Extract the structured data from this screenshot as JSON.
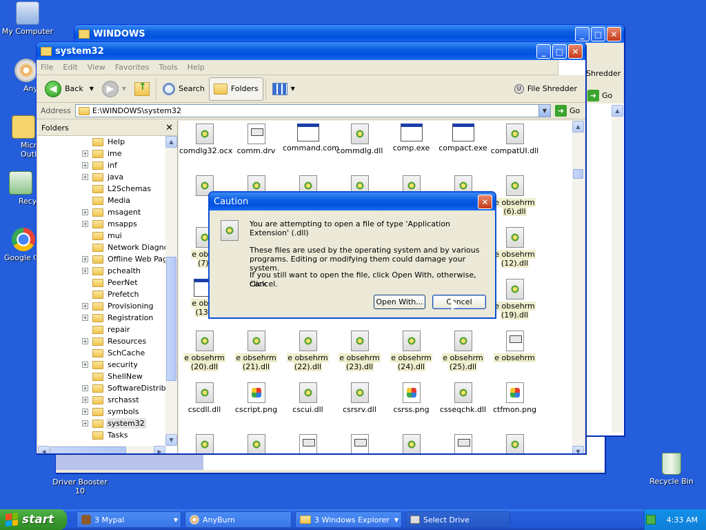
{
  "desktop": {
    "icons": [
      {
        "label": "My Computer"
      },
      {
        "label": "AnyBurn"
      },
      {
        "label": "Microsoft Outlook"
      },
      {
        "label": "Recycle"
      },
      {
        "label": "Google Chrome"
      },
      {
        "label": "Driver Booster 10"
      },
      {
        "label": "Recycle Bin"
      }
    ]
  },
  "window_windows": {
    "title": "WINDOWS",
    "toolbar_partial": "Shredder",
    "go_label": "Go"
  },
  "explorer": {
    "title": "system32",
    "menu": [
      "File",
      "Edit",
      "View",
      "Favorites",
      "Tools",
      "Help"
    ],
    "toolbar": {
      "back": "Back",
      "search": "Search",
      "folders": "Folders",
      "file_shredder": "File Shredder"
    },
    "address": {
      "label": "Address",
      "value": "E:\\WINDOWS\\system32",
      "go": "Go"
    },
    "folders_pane": {
      "title": "Folders",
      "items": [
        {
          "label": "Help",
          "expandable": false
        },
        {
          "label": "ime",
          "expandable": true
        },
        {
          "label": "inf",
          "expandable": true
        },
        {
          "label": "java",
          "expandable": true
        },
        {
          "label": "L2Schemas",
          "expandable": false
        },
        {
          "label": "Media",
          "expandable": false
        },
        {
          "label": "msagent",
          "expandable": true
        },
        {
          "label": "msapps",
          "expandable": true
        },
        {
          "label": "mui",
          "expandable": false
        },
        {
          "label": "Network Diagnost",
          "expandable": false
        },
        {
          "label": "Offline Web Page",
          "expandable": true
        },
        {
          "label": "pchealth",
          "expandable": true
        },
        {
          "label": "PeerNet",
          "expandable": false
        },
        {
          "label": "Prefetch",
          "expandable": false
        },
        {
          "label": "Provisioning",
          "expandable": true
        },
        {
          "label": "Registration",
          "expandable": true
        },
        {
          "label": "repair",
          "expandable": false
        },
        {
          "label": "Resources",
          "expandable": true
        },
        {
          "label": "SchCache",
          "expandable": false
        },
        {
          "label": "security",
          "expandable": true
        },
        {
          "label": "ShellNew",
          "expandable": false
        },
        {
          "label": "SoftwareDistribut",
          "expandable": true
        },
        {
          "label": "srchasst",
          "expandable": true
        },
        {
          "label": "symbols",
          "expandable": true
        },
        {
          "label": "system32",
          "expandable": true,
          "selected": true
        },
        {
          "label": "Tasks",
          "expandable": false
        }
      ]
    },
    "files": {
      "row1": [
        {
          "name": "comdlg32.ocx",
          "icon": "dll"
        },
        {
          "name": "comm.drv",
          "icon": "doc"
        },
        {
          "name": "command.com",
          "icon": "exe"
        },
        {
          "name": "commdlg.dll",
          "icon": "dll"
        },
        {
          "name": "comp.exe",
          "icon": "exe"
        },
        {
          "name": "compact.exe",
          "icon": "exe"
        },
        {
          "name": "compatUI.dll",
          "icon": "dll"
        }
      ],
      "row2_last": [
        "e obsehrm",
        "(6).dll"
      ],
      "row3_first": [
        "e obse",
        "(7)."
      ],
      "row3_last": [
        "e obsehrm",
        "(12).dll"
      ],
      "row4_first": [
        "e obse",
        "(13)."
      ],
      "row4_last": [
        "e obsehrm",
        "(19).dll"
      ],
      "row5": [
        {
          "l1": "e obsehrm",
          "l2": "(20).dll",
          "icon": "dll"
        },
        {
          "l1": "e obsehrm",
          "l2": "(21).dll",
          "icon": "dll"
        },
        {
          "l1": "e obsehrm",
          "l2": "(22).dll",
          "icon": "dll"
        },
        {
          "l1": "e obsehrm",
          "l2": "(23).dll",
          "icon": "dll"
        },
        {
          "l1": "e obsehrm",
          "l2": "(24).dll",
          "icon": "dll"
        },
        {
          "l1": "e obsehrm",
          "l2": "(25).dll",
          "icon": "dll"
        },
        {
          "l1": "e obsehrm",
          "l2": "",
          "icon": "doc"
        }
      ],
      "row6": [
        {
          "name": "cscdll.dll",
          "icon": "dll"
        },
        {
          "name": "cscript.png",
          "icon": "png"
        },
        {
          "name": "cscui.dll",
          "icon": "dll"
        },
        {
          "name": "csrsrv.dll",
          "icon": "dll"
        },
        {
          "name": "csrss.png",
          "icon": "png"
        },
        {
          "name": "csseqchk.dll",
          "icon": "dll"
        },
        {
          "name": "ctfmon.png",
          "icon": "png"
        }
      ]
    }
  },
  "dialog": {
    "title": "Caution",
    "line1": "You are attempting to open a file of type 'Application Extension' (.dll)",
    "line2": "These files are used by the operating system and by various",
    "line3": "programs. Editing or modifying them could damage your system.",
    "line4": "If you still want to open the file, click Open With, otherwise, click",
    "line5": "Cancel.",
    "open_with": "Open With...",
    "cancel": "Cancel"
  },
  "taskbar": {
    "start": "start",
    "buttons": [
      {
        "label": "3 Mypal"
      },
      {
        "label": "AnyBurn"
      },
      {
        "label": "3 Windows Explorer"
      },
      {
        "label": "Select Drive"
      }
    ],
    "clock": "4:33 AM"
  },
  "colors": {
    "desktop": "#245edb",
    "titlebar": "#0a5ee0",
    "start": "#3a9a30"
  }
}
